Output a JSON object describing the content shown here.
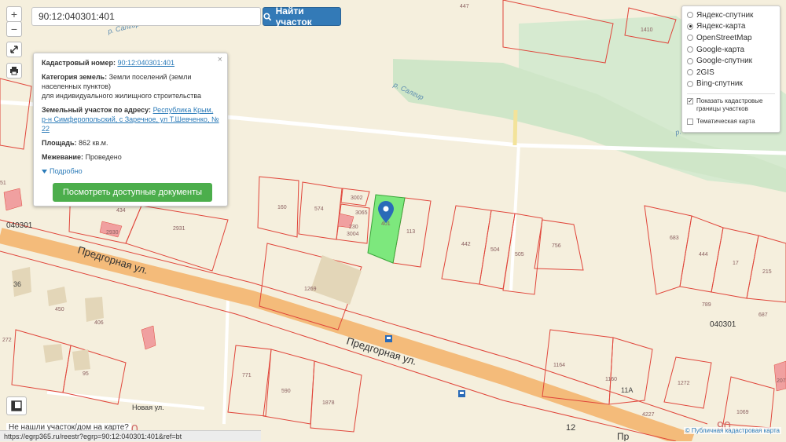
{
  "search": {
    "value": "90:12:040301:401",
    "button_label": "Найти участок"
  },
  "zoom": {
    "in_label": "+",
    "out_label": "−"
  },
  "info": {
    "cadastral_label": "Кадастровый номер:",
    "cadastral_value": "90:12:040301:401",
    "category_label": "Категория земель:",
    "category_value": "Земли поселений (земли населенных пунктов)",
    "category_purpose": "для индивидуального жилищного строительства",
    "address_label": "Земельный участок по адресу:",
    "address_value": "Республика Крым, р-н Симферопольский, с Заречное, ул Т.Шевченко, № 22",
    "area_label": "Площадь:",
    "area_value": "862 кв.м.",
    "survey_label": "Межевание:",
    "survey_value": "Проведено",
    "more_label": "Подробно",
    "docs_button": "Посмотреть доступные документы",
    "close": "×"
  },
  "layers": {
    "options": [
      {
        "label": "Яндекс-спутник",
        "selected": false
      },
      {
        "label": "Яндекс-карта",
        "selected": true
      },
      {
        "label": "OpenStreetMap",
        "selected": false
      },
      {
        "label": "Google-карта",
        "selected": false
      },
      {
        "label": "Google-спутник",
        "selected": false
      },
      {
        "label": "2GIS",
        "selected": false
      },
      {
        "label": "Bing-спутник",
        "selected": false
      }
    ],
    "show_boundaries": "Показать кадастровые границы участков",
    "thematic": "Тематическая карта"
  },
  "map_labels": {
    "street_main": "Предгорная ул.",
    "street_main2": "Предгорная ул.",
    "street_novaya": "Новая ул.",
    "river1": "р. Салгир",
    "river2": "р. Салгир",
    "river3": "р. Салгир",
    "quarter_left": "040301",
    "quarter_right": "040301",
    "house_12": "12",
    "edge_pr": "Пр",
    "edge_90": "90",
    "edge_00": "00"
  },
  "parcels": [
    "447",
    "1410",
    "160",
    "574",
    "3002",
    "3065",
    "230",
    "3004",
    "401",
    "113",
    "442",
    "504",
    "505",
    "756",
    "683",
    "444",
    "17",
    "215",
    "789",
    "687",
    "434",
    "2930",
    "2931",
    "1269",
    "36",
    "450",
    "406",
    "272",
    "95",
    "771",
    "590",
    "1878",
    "1164",
    "1160",
    "11А",
    "1272",
    "4227",
    "1069",
    "51",
    "2074"
  ],
  "status_url": "https://egrp365.ru/reestr?egrp=90:12:040301:401&ref=bt",
  "not_found": "Не нашли участок/дом на карте?",
  "attribution": "© Публичная кадастровая карта",
  "colors": {
    "selected_parcel": "#7de87d",
    "boundary": "#e0453a",
    "road": "#f4bb7a",
    "greenery": "#d6ead0",
    "button_blue": "#337ab7",
    "button_green": "#4cae4c"
  }
}
